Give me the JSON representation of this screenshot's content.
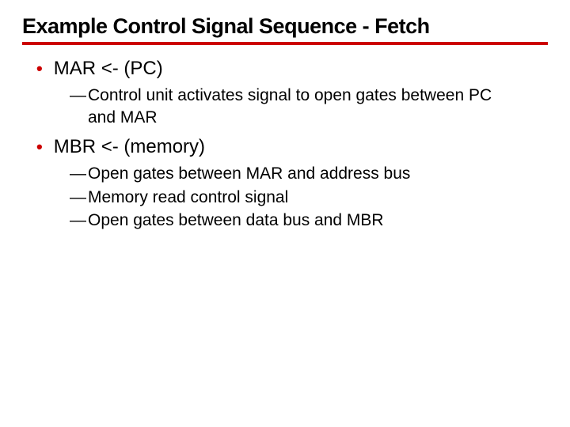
{
  "title": "Example Control Signal Sequence - Fetch",
  "items": [
    {
      "text": "MAR <- (PC)",
      "sub": [
        "Control unit activates signal to open gates between PC and MAR"
      ]
    },
    {
      "text": "MBR <- (memory)",
      "sub": [
        "Open gates between MAR and address bus",
        "Memory read control signal",
        "Open gates between data bus and MBR"
      ]
    }
  ]
}
